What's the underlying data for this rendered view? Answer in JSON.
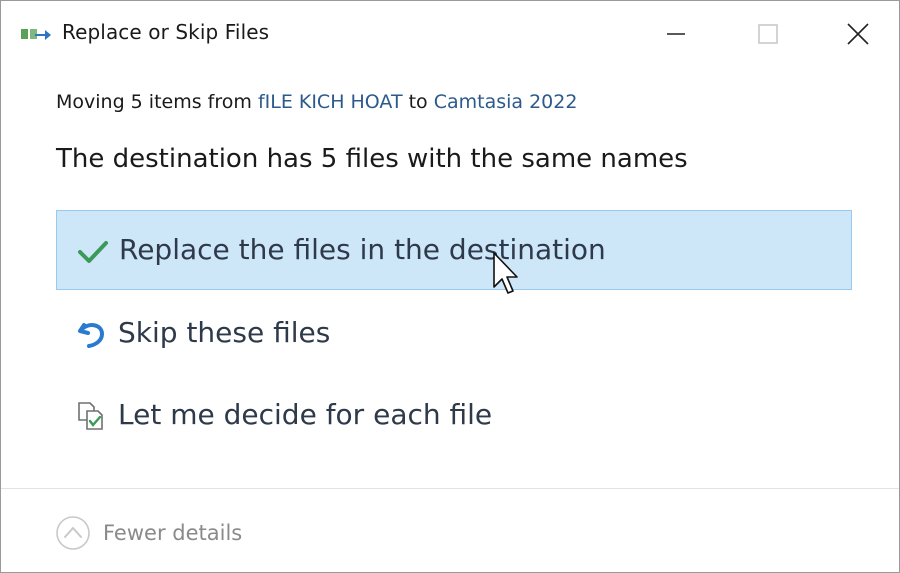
{
  "window": {
    "title": "Replace or Skip Files",
    "controls": {
      "minimize": "minimize",
      "maximize": "maximize",
      "close": "close"
    }
  },
  "header": {
    "moving_prefix": "Moving 5 items from ",
    "source": "fILE KICH HOAT",
    "to_word": " to ",
    "destination": "Camtasia 2022",
    "conflict_message": "The destination has 5 files with the same names"
  },
  "options": [
    {
      "label": "Replace the files in the destination",
      "icon": "checkmark-icon",
      "selected": true
    },
    {
      "label": "Skip these files",
      "icon": "skip-arrow-icon",
      "selected": false
    },
    {
      "label": "Let me decide for each file",
      "icon": "compare-files-icon",
      "selected": false
    }
  ],
  "footer": {
    "details_label": "Fewer details",
    "details_icon": "chevron-up-circle-icon"
  },
  "colors": {
    "accent_link": "#2d5a8c",
    "selected_bg": "#cde6f8",
    "selected_border": "#99c9ef",
    "check_green": "#3a9a5a",
    "skip_blue": "#2a7bd0"
  }
}
